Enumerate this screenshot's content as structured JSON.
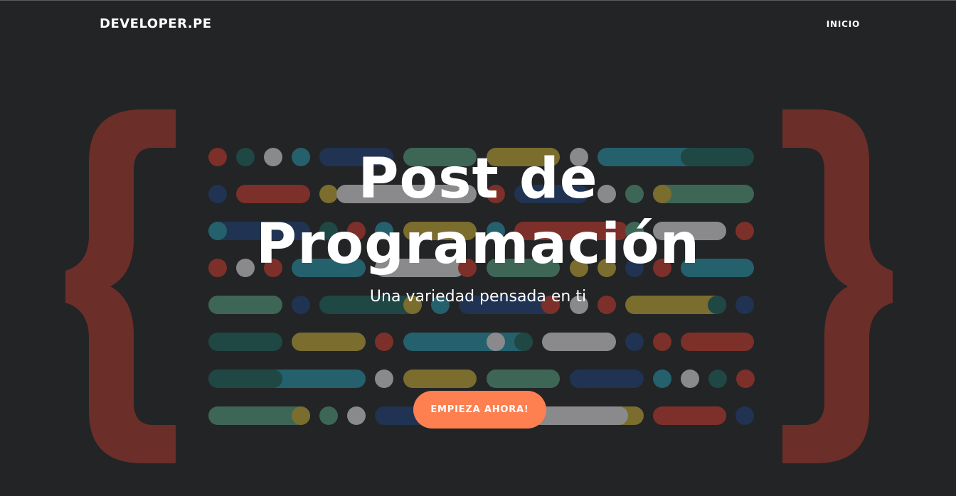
{
  "nav": {
    "brand": "DEVELOPER.PE",
    "links": [
      {
        "label": "INICIO"
      }
    ]
  },
  "hero": {
    "title_line1": "Post de",
    "title_line2": "Programación",
    "subtitle": "Una variedad pensada en ti",
    "cta_label": "EMPIEZA AHORA!"
  },
  "colors": {
    "background": "#232426",
    "brace": "#6b2e29",
    "cta": "#fe8050",
    "text": "#ffffff",
    "code_red": "#7d3029",
    "code_teal": "#25606d",
    "code_green": "#3e6656",
    "code_olive": "#7a6d2e",
    "code_gray": "#8a8a8c",
    "code_navy": "#203352",
    "code_dark_teal": "#1f4744"
  },
  "background_art": {
    "left_brace": "{",
    "right_brace": "}",
    "pattern": "code-lines-icon"
  }
}
